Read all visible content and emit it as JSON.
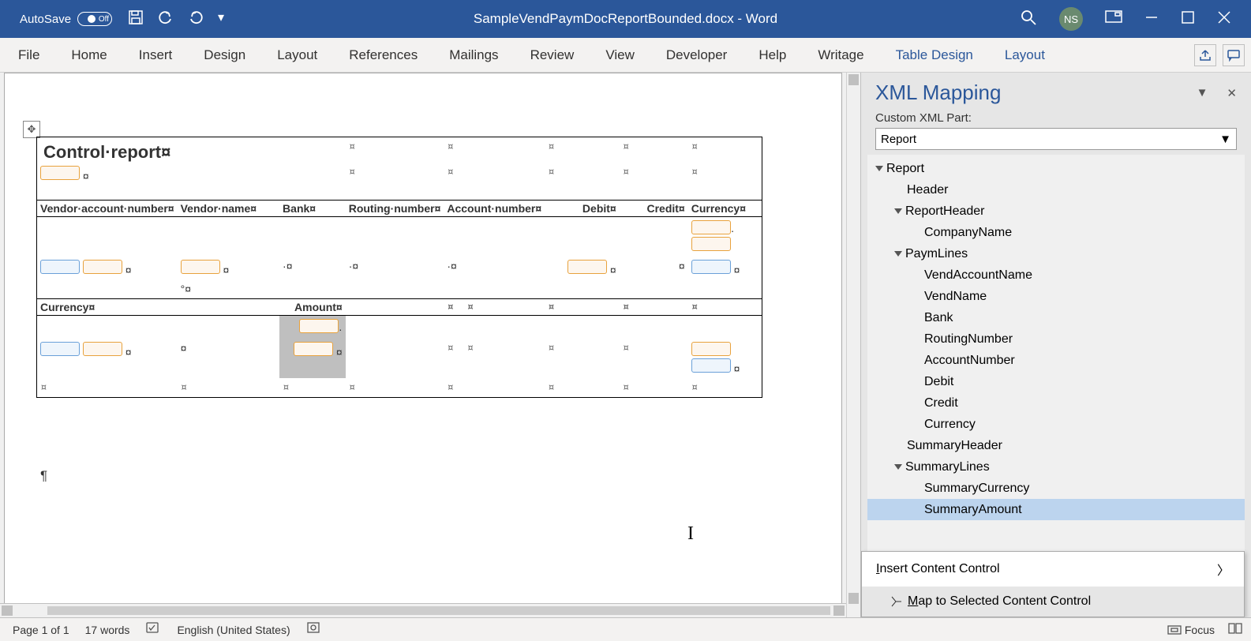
{
  "titlebar": {
    "autosave_label": "AutoSave",
    "autosave_state": "Off",
    "document_title": "SampleVendPaymDocReportBounded.docx  -  Word",
    "user_initials": "NS"
  },
  "ribbon": {
    "tabs": [
      "File",
      "Home",
      "Insert",
      "Design",
      "Layout",
      "References",
      "Mailings",
      "Review",
      "View",
      "Developer",
      "Help",
      "Writage"
    ],
    "context_tabs": [
      "Table Design",
      "Layout"
    ]
  },
  "document": {
    "title": "Control·report¤",
    "headers_row1": [
      "Vendor·account·number¤",
      "Vendor·name¤",
      "Bank¤",
      "Routing·number¤",
      "Account·number¤",
      "Debit¤",
      "Credit¤",
      "Currency¤"
    ],
    "headers_row2": [
      "Currency¤",
      "Amount¤"
    ]
  },
  "xml_pane": {
    "title": "XML Mapping",
    "label": "Custom XML Part:",
    "selected_part": "Report",
    "tree": {
      "root": "Report",
      "children": [
        "Header",
        {
          "name": "ReportHeader",
          "children": [
            "CompanyName"
          ]
        },
        {
          "name": "PaymLines",
          "children": [
            "VendAccountName",
            "VendName",
            "Bank",
            "RoutingNumber",
            "AccountNumber",
            "Debit",
            "Credit",
            "Currency"
          ]
        },
        "SummaryHeader",
        {
          "name": "SummaryLines",
          "children": [
            "SummaryCurrency",
            "SummaryAmount"
          ]
        }
      ]
    },
    "selected_node": "SummaryAmount",
    "context_menu": {
      "item1": "Insert Content Control",
      "item2": "Map to Selected Content Control"
    }
  },
  "statusbar": {
    "page": "Page 1 of 1",
    "words": "17 words",
    "language": "English (United States)",
    "focus": "Focus"
  }
}
